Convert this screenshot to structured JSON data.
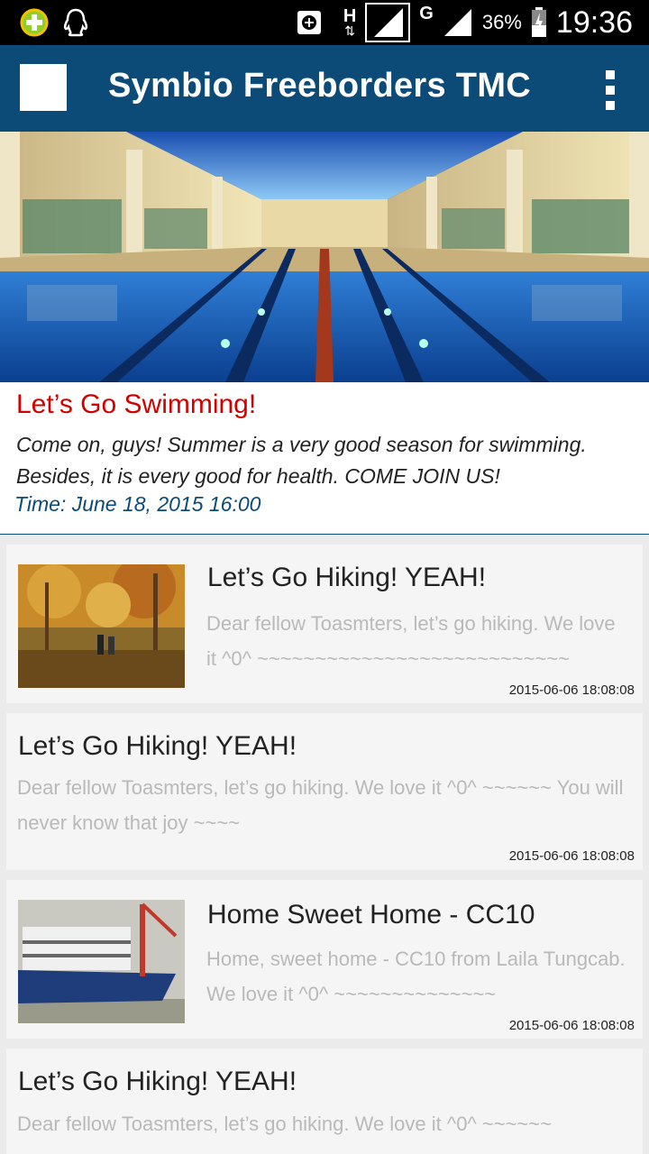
{
  "status_bar": {
    "network_h": "H",
    "network_g": "G",
    "battery_percent": "36%",
    "time": "19:36",
    "icons": [
      "add-circle-icon",
      "qq-penguin-icon",
      "data-saver-icon",
      "signal-icon",
      "battery-icon"
    ]
  },
  "app_bar": {
    "title": "Symbio Freeborders TMC",
    "icons": [
      "app-logo-icon",
      "overflow-menu-icon"
    ],
    "color": "#0c4a78"
  },
  "featured": {
    "title": "Let’s Go Swimming!",
    "body": "Come on, guys! Summer is a very good season for swimming. Besides, it is every good for health. COME JOIN US!",
    "time": "Time: June 18, 2015 16:00",
    "title_color": "#d40000"
  },
  "posts": [
    {
      "title": "Let’s Go Hiking! YEAH!",
      "desc": "Dear fellow Toasmters, let’s go hiking. We love it ^0^ ~~~~~~~~~~~~~~~~~~~~~~~~~~~",
      "date": "2015-06-06 18:08:08"
    },
    {
      "title": "Let’s Go Hiking! YEAH!",
      "desc": "Dear fellow Toasmters, let’s go hiking. We love it ^0^ ~~~~~~ You will never know that joy ~~~~",
      "date": "2015-06-06 18:08:08"
    },
    {
      "title": "Home Sweet Home - CC10",
      "desc": "Home, sweet home - CC10 from Laila Tungcab. We love it ^0^ ~~~~~~~~~~~~~~",
      "date": "2015-06-06 18:08:08"
    },
    {
      "title": "Let’s Go Hiking! YEAH!",
      "desc": "Dear fellow Toasmters, let’s go hiking. We love it ^0^ ~~~~~~",
      "date": ""
    }
  ]
}
